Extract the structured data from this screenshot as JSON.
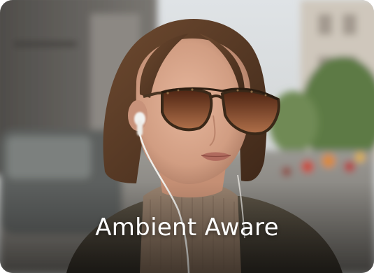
{
  "card": {
    "caption": "Ambient Aware"
  },
  "image": {
    "subject": "woman-with-wired-earphones-and-sunglasses"
  },
  "colors": {
    "caption_text": "#ffffff",
    "sky": "#d8dde0",
    "hair": "#5b3b26",
    "skin": "#d9a88e",
    "lens": "#7a3e1e",
    "sweater": "#8a7563",
    "coat": "#4a4438"
  }
}
